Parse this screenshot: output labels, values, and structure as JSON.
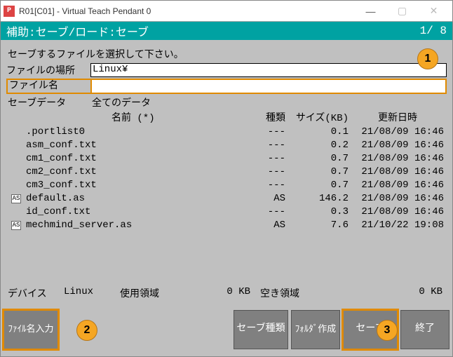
{
  "window": {
    "title": "R01[C01] - Virtual Teach Pendant 0",
    "icon_letter": "P"
  },
  "subheader": {
    "left": "補助:セーブ/ロード:セーブ",
    "right": "1/ 8"
  },
  "prompt": "セーブするファイルを選択して下さい。",
  "location": {
    "label": "ファイルの場所",
    "value": "Linux¥"
  },
  "filename": {
    "label": "ファイル名",
    "value": ""
  },
  "savedata": {
    "label": "セーブデータ",
    "value": "全てのデータ"
  },
  "headers": {
    "name": "名前  (*)",
    "kind": "種類",
    "size": "サイズ(KB)",
    "date": "更新日時"
  },
  "files": [
    {
      "icon": "",
      "name": ".portlist0",
      "kind": "---",
      "size": "0.1",
      "date": "21/08/09 16:46"
    },
    {
      "icon": "",
      "name": "asm_conf.txt",
      "kind": "---",
      "size": "0.2",
      "date": "21/08/09 16:46"
    },
    {
      "icon": "",
      "name": "cm1_conf.txt",
      "kind": "---",
      "size": "0.7",
      "date": "21/08/09 16:46"
    },
    {
      "icon": "",
      "name": "cm2_conf.txt",
      "kind": "---",
      "size": "0.7",
      "date": "21/08/09 16:46"
    },
    {
      "icon": "",
      "name": "cm3_conf.txt",
      "kind": "---",
      "size": "0.7",
      "date": "21/08/09 16:46"
    },
    {
      "icon": "AS",
      "name": "default.as",
      "kind": "AS",
      "size": "146.2",
      "date": "21/08/09 16:46"
    },
    {
      "icon": "",
      "name": "id_conf.txt",
      "kind": "---",
      "size": "0.3",
      "date": "21/08/09 16:46"
    },
    {
      "icon": "AS",
      "name": "mechmind_server.as",
      "kind": "AS",
      "size": "7.6",
      "date": "21/10/22 19:08"
    }
  ],
  "device": {
    "label": "デバイス",
    "value": "Linux",
    "used_label": "使用領域",
    "used_value": "0 KB",
    "free_label": "空き領域",
    "free_value": "0 KB"
  },
  "buttons": {
    "filename_input": "ﾌｧｲﾙ名入力",
    "save_type": "セーブ種類",
    "mkdir": "ﾌｫﾙﾀﾞ作成",
    "save": "セーブ",
    "exit": "終了"
  },
  "callouts": {
    "c1": "1",
    "c2": "2",
    "c3": "3"
  }
}
